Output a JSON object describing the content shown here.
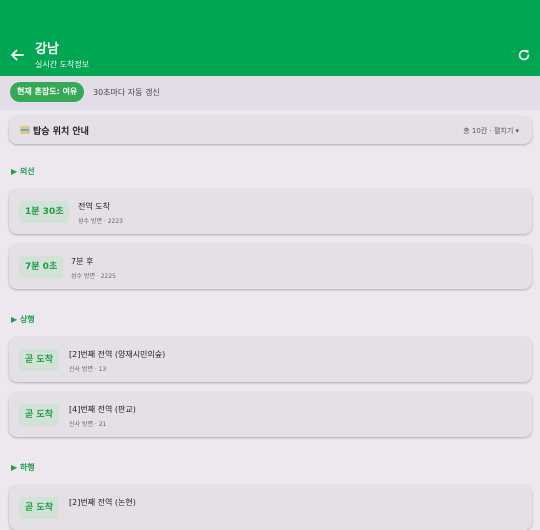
{
  "appbar": {
    "title": "강남",
    "subtitle": "실시간 도착정보",
    "back_icon": "arrow-left-icon",
    "refresh_icon": "refresh-icon",
    "color": "#00a651"
  },
  "status": {
    "congestion": "현재 혼잡도: 여유",
    "autorefresh": "30초마다 자동 갱신"
  },
  "guide": {
    "title": "탑승 위치 안내",
    "meta": "총 10칸 · 펼치기 ▾"
  },
  "sections": [
    {
      "title": "▶ 외선",
      "items": [
        {
          "badge": "1분 30초",
          "main": "전역 도착",
          "sub": "성수 방면 · 2223"
        },
        {
          "badge": "7분 0초",
          "main": "7분 후",
          "sub": "성수 방면 · 2225"
        }
      ]
    },
    {
      "title": "▶ 상행",
      "items": [
        {
          "badge": "곧 도착",
          "main": "[2]번째 전역 (양재시민의숲)",
          "sub": "신사 방면 · 13"
        },
        {
          "badge": "곧 도착",
          "main": "[4]번째 전역 (판교)",
          "sub": "신사 방면 · 21"
        }
      ]
    },
    {
      "title": "▶ 하행",
      "items": [
        {
          "badge": "곧 도착",
          "main": "[2]번째 전역 (논현)",
          "sub": ""
        }
      ]
    }
  ]
}
